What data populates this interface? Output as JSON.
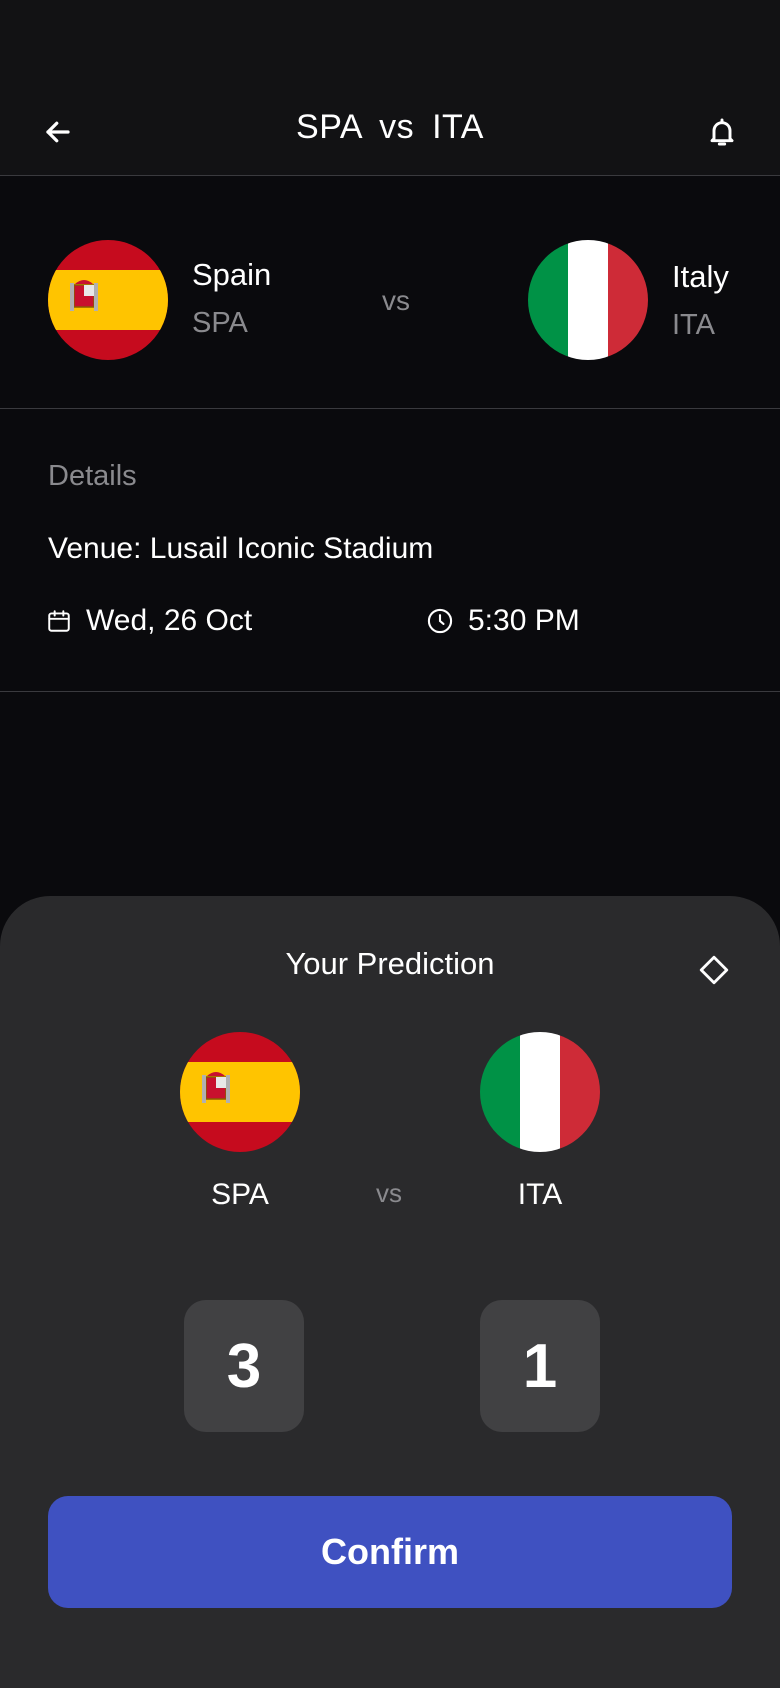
{
  "header": {
    "title": "SPA  vs  ITA",
    "back_icon": "arrow-left-icon",
    "bell_icon": "bell-icon"
  },
  "match": {
    "home": {
      "name": "Spain",
      "code": "SPA",
      "flag": "spain-flag"
    },
    "away": {
      "name": "Italy",
      "code": "ITA",
      "flag": "italy-flag"
    },
    "vs": "vs"
  },
  "details": {
    "label": "Details",
    "venue": "Venue: Lusail Iconic Stadium",
    "date": "Wed, 26 Oct",
    "time": "5:30 PM",
    "date_icon": "calendar-icon",
    "time_icon": "clock-icon"
  },
  "prediction": {
    "title": "Your Prediction",
    "edit_icon": "diamond-icon",
    "home_code": "SPA",
    "away_code": "ITA",
    "vs": "vs",
    "home_score": "3",
    "away_score": "1",
    "confirm_label": "Confirm"
  },
  "colors": {
    "background": "#0a0a0d",
    "sheet": "#2a2a2c",
    "accent": "#3f51c1",
    "muted": "#8a8a8e"
  }
}
